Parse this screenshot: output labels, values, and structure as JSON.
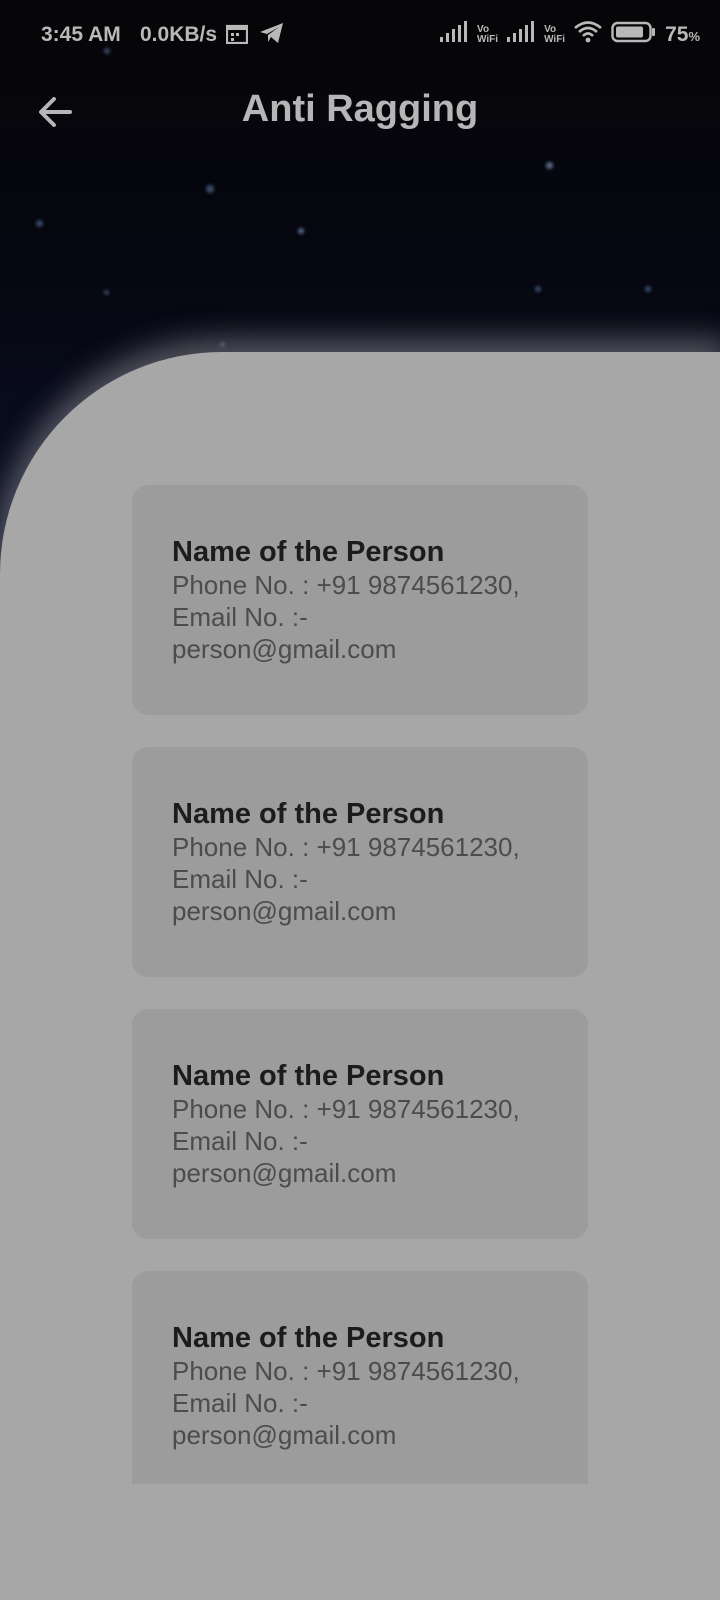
{
  "status_bar": {
    "time": "3:45 AM",
    "network_speed": "0.0KB/s",
    "vowifi_label_1": "Vo",
    "vowifi_label_2": "WiFi",
    "battery_percent": "75",
    "battery_unit": "%",
    "icons": [
      "calendar-icon",
      "telegram-icon",
      "signal-icon",
      "signal-icon",
      "wifi-icon",
      "battery-icon"
    ]
  },
  "app_bar": {
    "title": "Anti Ragging",
    "back_icon": "arrow-left-icon"
  },
  "contacts": [
    {
      "name": "Name of the Person",
      "phone": "Phone No. : +91 9874561230,",
      "email_label": "Email No. :-",
      "email": "person@gmail.com"
    },
    {
      "name": "Name of the Person",
      "phone": "Phone No. : +91 9874561230,",
      "email_label": "Email No. :-",
      "email": "person@gmail.com"
    },
    {
      "name": "Name of the Person",
      "phone": "Phone No. : +91 9874561230,",
      "email_label": "Email No. :-",
      "email": "person@gmail.com"
    },
    {
      "name": "Name of the Person",
      "phone": "Phone No. : +91 9874561230,",
      "email_label": "Email No. :-",
      "email": "person@gmail.com"
    }
  ],
  "colors": {
    "panel": "#a7a7a7",
    "card": "#9c9c9c",
    "sky": "#05060f"
  }
}
